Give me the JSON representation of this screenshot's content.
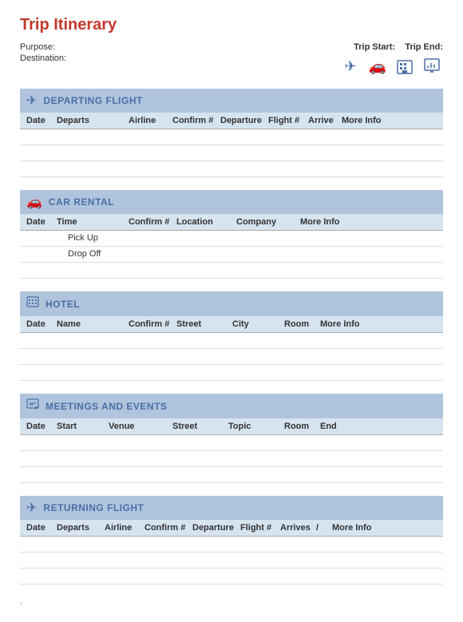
{
  "title": "Trip Itinerary",
  "meta": {
    "purpose_label": "Purpose:",
    "destination_label": "Destination:",
    "trip_start_label": "Trip Start:",
    "trip_end_label": "Trip End:"
  },
  "icons": {
    "plane": "✈",
    "car": "🚗",
    "hotel": "🏢",
    "chart": "📊"
  },
  "departing_flight": {
    "section_title": "DEPARTING FLIGHT",
    "columns": {
      "date": "Date",
      "departs": "Departs",
      "airline": "Airline",
      "confirm": "Confirm #",
      "departure": "Departure",
      "flight": "Flight #",
      "arrive": "Arrive",
      "more_info": "More Info"
    }
  },
  "car_rental": {
    "section_title": "CAR RENTAL",
    "columns": {
      "date": "Date",
      "time": "Time",
      "confirm": "Confirm #",
      "location": "Location",
      "company": "Company",
      "more_info": "More Info"
    },
    "rows": [
      {
        "label": "Pick Up"
      },
      {
        "label": "Drop Off"
      }
    ]
  },
  "hotel": {
    "section_title": "HOTEL",
    "columns": {
      "date": "Date",
      "name": "Name",
      "confirm": "Confirm #",
      "street": "Street",
      "city": "City",
      "room": "Room",
      "more_info": "More Info"
    }
  },
  "meetings": {
    "section_title": "MEETINGS AND EVENTS",
    "columns": {
      "date": "Date",
      "start": "Start",
      "venue": "Venue",
      "street": "Street",
      "topic": "Topic",
      "room": "Room",
      "end": "End"
    }
  },
  "returning_flight": {
    "section_title": "RETURNING FLIGHT",
    "columns": {
      "date": "Date",
      "departs": "Departs",
      "airline": "Airline",
      "confirm": "Confirm #",
      "departure": "Departure",
      "flight": "Flight #",
      "arrives": "Arrives",
      "more_icon": "/",
      "more_info": "More Info"
    }
  },
  "footer": "."
}
